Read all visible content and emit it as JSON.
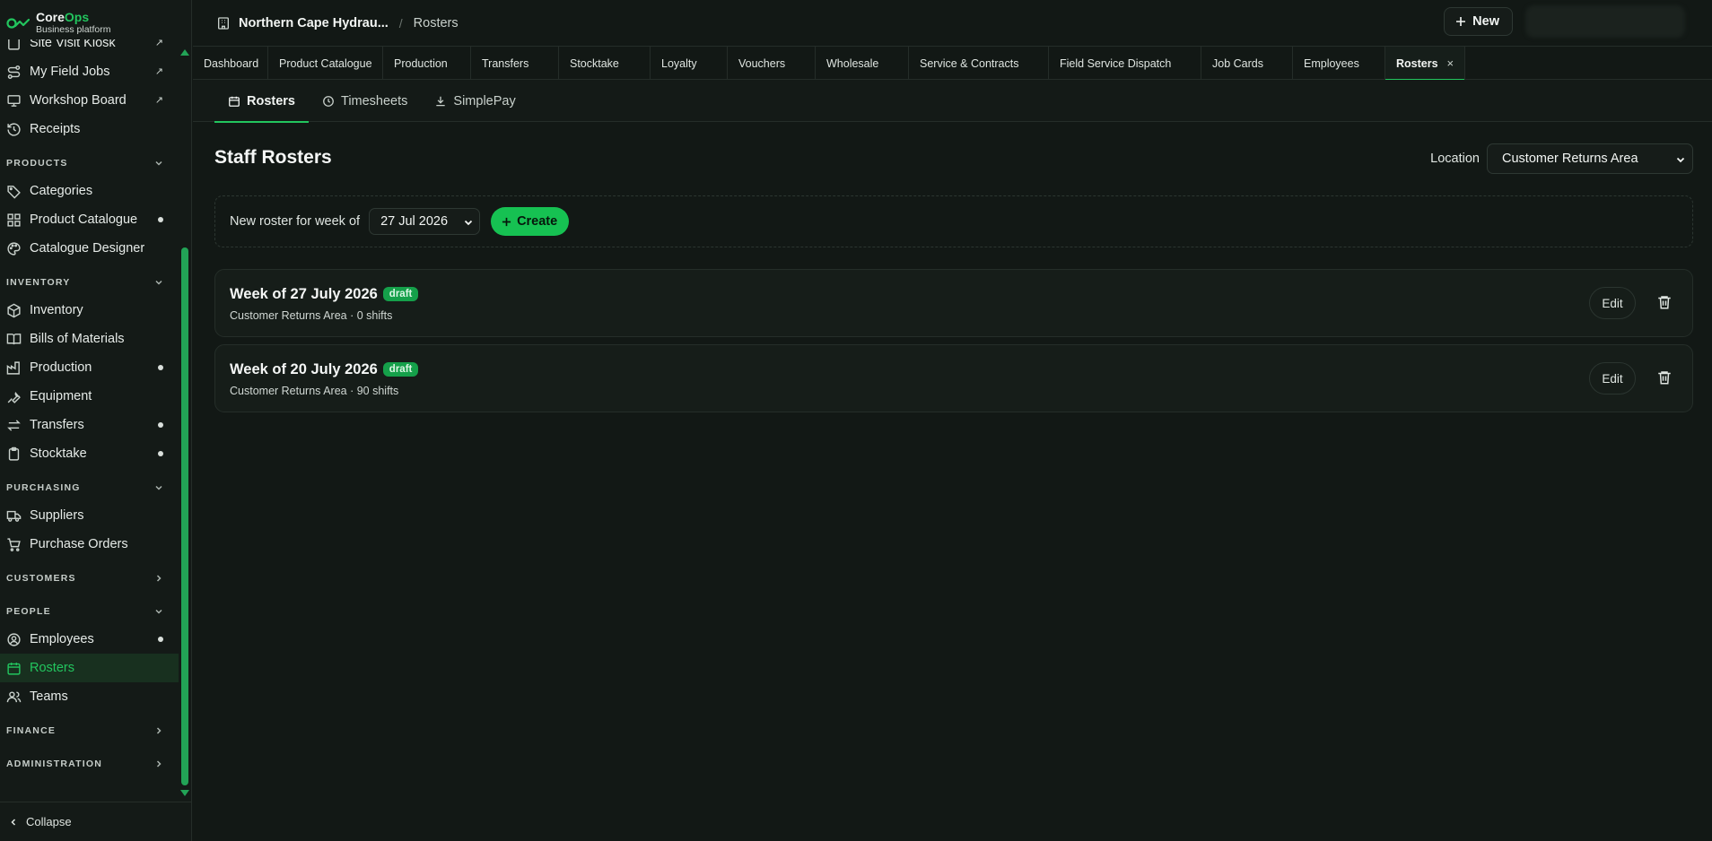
{
  "brand": {
    "name_part1": "Core",
    "name_part2": "Ops",
    "subtitle": "Business platform"
  },
  "sidebar": {
    "top_items": [
      {
        "label": "Site Visit Kiosk",
        "icon": "kiosk-icon",
        "external": true
      },
      {
        "label": "My Field Jobs",
        "icon": "route-icon",
        "external": true
      },
      {
        "label": "Workshop Board",
        "icon": "monitor-icon",
        "external": true
      },
      {
        "label": "Receipts",
        "icon": "history-icon"
      }
    ],
    "sections": {
      "products": {
        "label": "PRODUCTS",
        "items": [
          "Categories",
          "Product Catalogue",
          "Catalogue Designer"
        ]
      },
      "inventory": {
        "label": "INVENTORY",
        "items": [
          "Inventory",
          "Bills of Materials",
          "Production",
          "Equipment",
          "Transfers",
          "Stocktake"
        ]
      },
      "purchasing": {
        "label": "PURCHASING",
        "items": [
          "Suppliers",
          "Purchase Orders"
        ]
      },
      "customers": {
        "label": "CUSTOMERS"
      },
      "people": {
        "label": "PEOPLE",
        "items": [
          "Employees",
          "Rosters",
          "Teams"
        ]
      },
      "finance": {
        "label": "FINANCE"
      },
      "administration": {
        "label": "ADMINISTRATION"
      }
    },
    "collapse_label": "Collapse",
    "ext_glyph": "↗"
  },
  "topbar": {
    "org": "Northern Cape Hydrau...",
    "separator": "/",
    "page": "Rosters",
    "new_label": "New"
  },
  "tabs": [
    "Dashboard",
    "Product Catalogue",
    "Production",
    "Transfers",
    "Stocktake",
    "Loyalty",
    "Vouchers",
    "Wholesale",
    "Service & Contracts",
    "Field Service Dispatch",
    "Job Cards",
    "Employees",
    "Rosters"
  ],
  "tab_close": "×",
  "subtabs": [
    "Rosters",
    "Timesheets",
    "SimplePay"
  ],
  "main": {
    "title": "Staff Rosters",
    "location_label": "Location",
    "location_value": "Customer Returns Area",
    "new_roster_label": "New roster for week of",
    "week_value": "27 Jul 2026",
    "create_label": "Create"
  },
  "rosters": [
    {
      "title": "Week of 27 July 2026",
      "status": "draft",
      "meta": "Customer Returns Area · 0 shifts",
      "edit": "Edit"
    },
    {
      "title": "Week of 20 July 2026",
      "status": "draft",
      "meta": "Customer Returns Area · 90 shifts",
      "edit": "Edit"
    }
  ],
  "colors": {
    "accent": "#22c55e",
    "background": "#121815",
    "badge": "#15a04a"
  }
}
